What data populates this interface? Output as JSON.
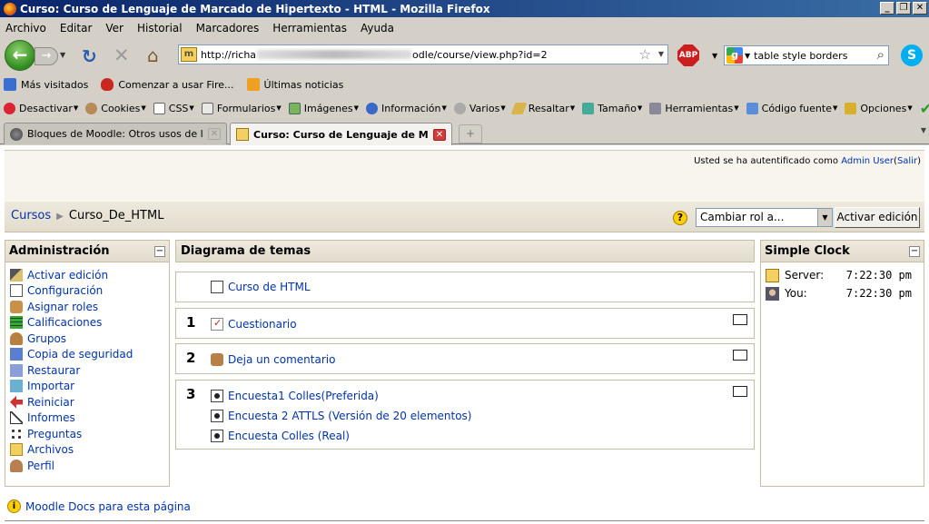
{
  "window": {
    "title": "Curso: Curso de Lenguaje de Marcado de Hipertexto - HTML - Mozilla Firefox",
    "minimize": "_",
    "restore": "❐",
    "close": "✕"
  },
  "menu": [
    "Archivo",
    "Editar",
    "Ver",
    "Historial",
    "Marcadores",
    "Herramientas",
    "Ayuda"
  ],
  "navbar": {
    "url_prefix": "http://richa",
    "url_suffix": "odle/course/view.php?id=2",
    "search_value": "table style borders",
    "abp_label": "ABP"
  },
  "bookmarks": [
    "Más visitados",
    "Comenzar a usar Fire...",
    "Últimas noticias"
  ],
  "devbar": [
    "Desactivar",
    "Cookies",
    "CSS",
    "Formularios",
    "Imágenes",
    "Información",
    "Varios",
    "Resaltar",
    "Tamaño",
    "Herramientas",
    "Código fuente",
    "Opciones"
  ],
  "tabs": [
    {
      "label": "Bloques de Moodle: Otros usos de los b...",
      "active": false
    },
    {
      "label": "Curso: Curso de Lenguaje de Mar...",
      "active": true
    }
  ],
  "page": {
    "login_text": "Usted se ha autentificado como",
    "login_user": "Admin User",
    "logout_open": "(",
    "logout": "Salir",
    "logout_close": ")",
    "breadcrumb_root": "Cursos",
    "breadcrumb_sep": "▶",
    "breadcrumb_current": "Curso_De_HTML",
    "help_label": "?",
    "role_select": "Cambiar rol a...",
    "edit_button": "Activar edición",
    "footer_docs": "Moodle Docs para esta página"
  },
  "admin": {
    "title": "Administración",
    "items": [
      "Activar edición",
      "Configuración",
      "Asignar roles",
      "Calificaciones",
      "Grupos",
      "Copia de seguridad",
      "Restaurar",
      "Importar",
      "Reiniciar",
      "Informes",
      "Preguntas",
      "Archivos",
      "Perfil"
    ]
  },
  "topics": {
    "title": "Diagrama de temas",
    "section0": "Curso de HTML",
    "sections": [
      {
        "num": "1",
        "items": [
          "Cuestionario"
        ]
      },
      {
        "num": "2",
        "items": [
          "Deja un comentario"
        ]
      },
      {
        "num": "3",
        "items": [
          "Encuesta1 Colles(Preferida)",
          "Encuesta 2 ATTLS (Versión de 20 elementos)",
          "Encuesta Colles (Real)"
        ]
      }
    ]
  },
  "clock": {
    "title": "Simple Clock",
    "server_label": "Server:",
    "server_time": "7:22:30 pm",
    "you_label": "You:",
    "you_time": "7:22:30 pm"
  }
}
